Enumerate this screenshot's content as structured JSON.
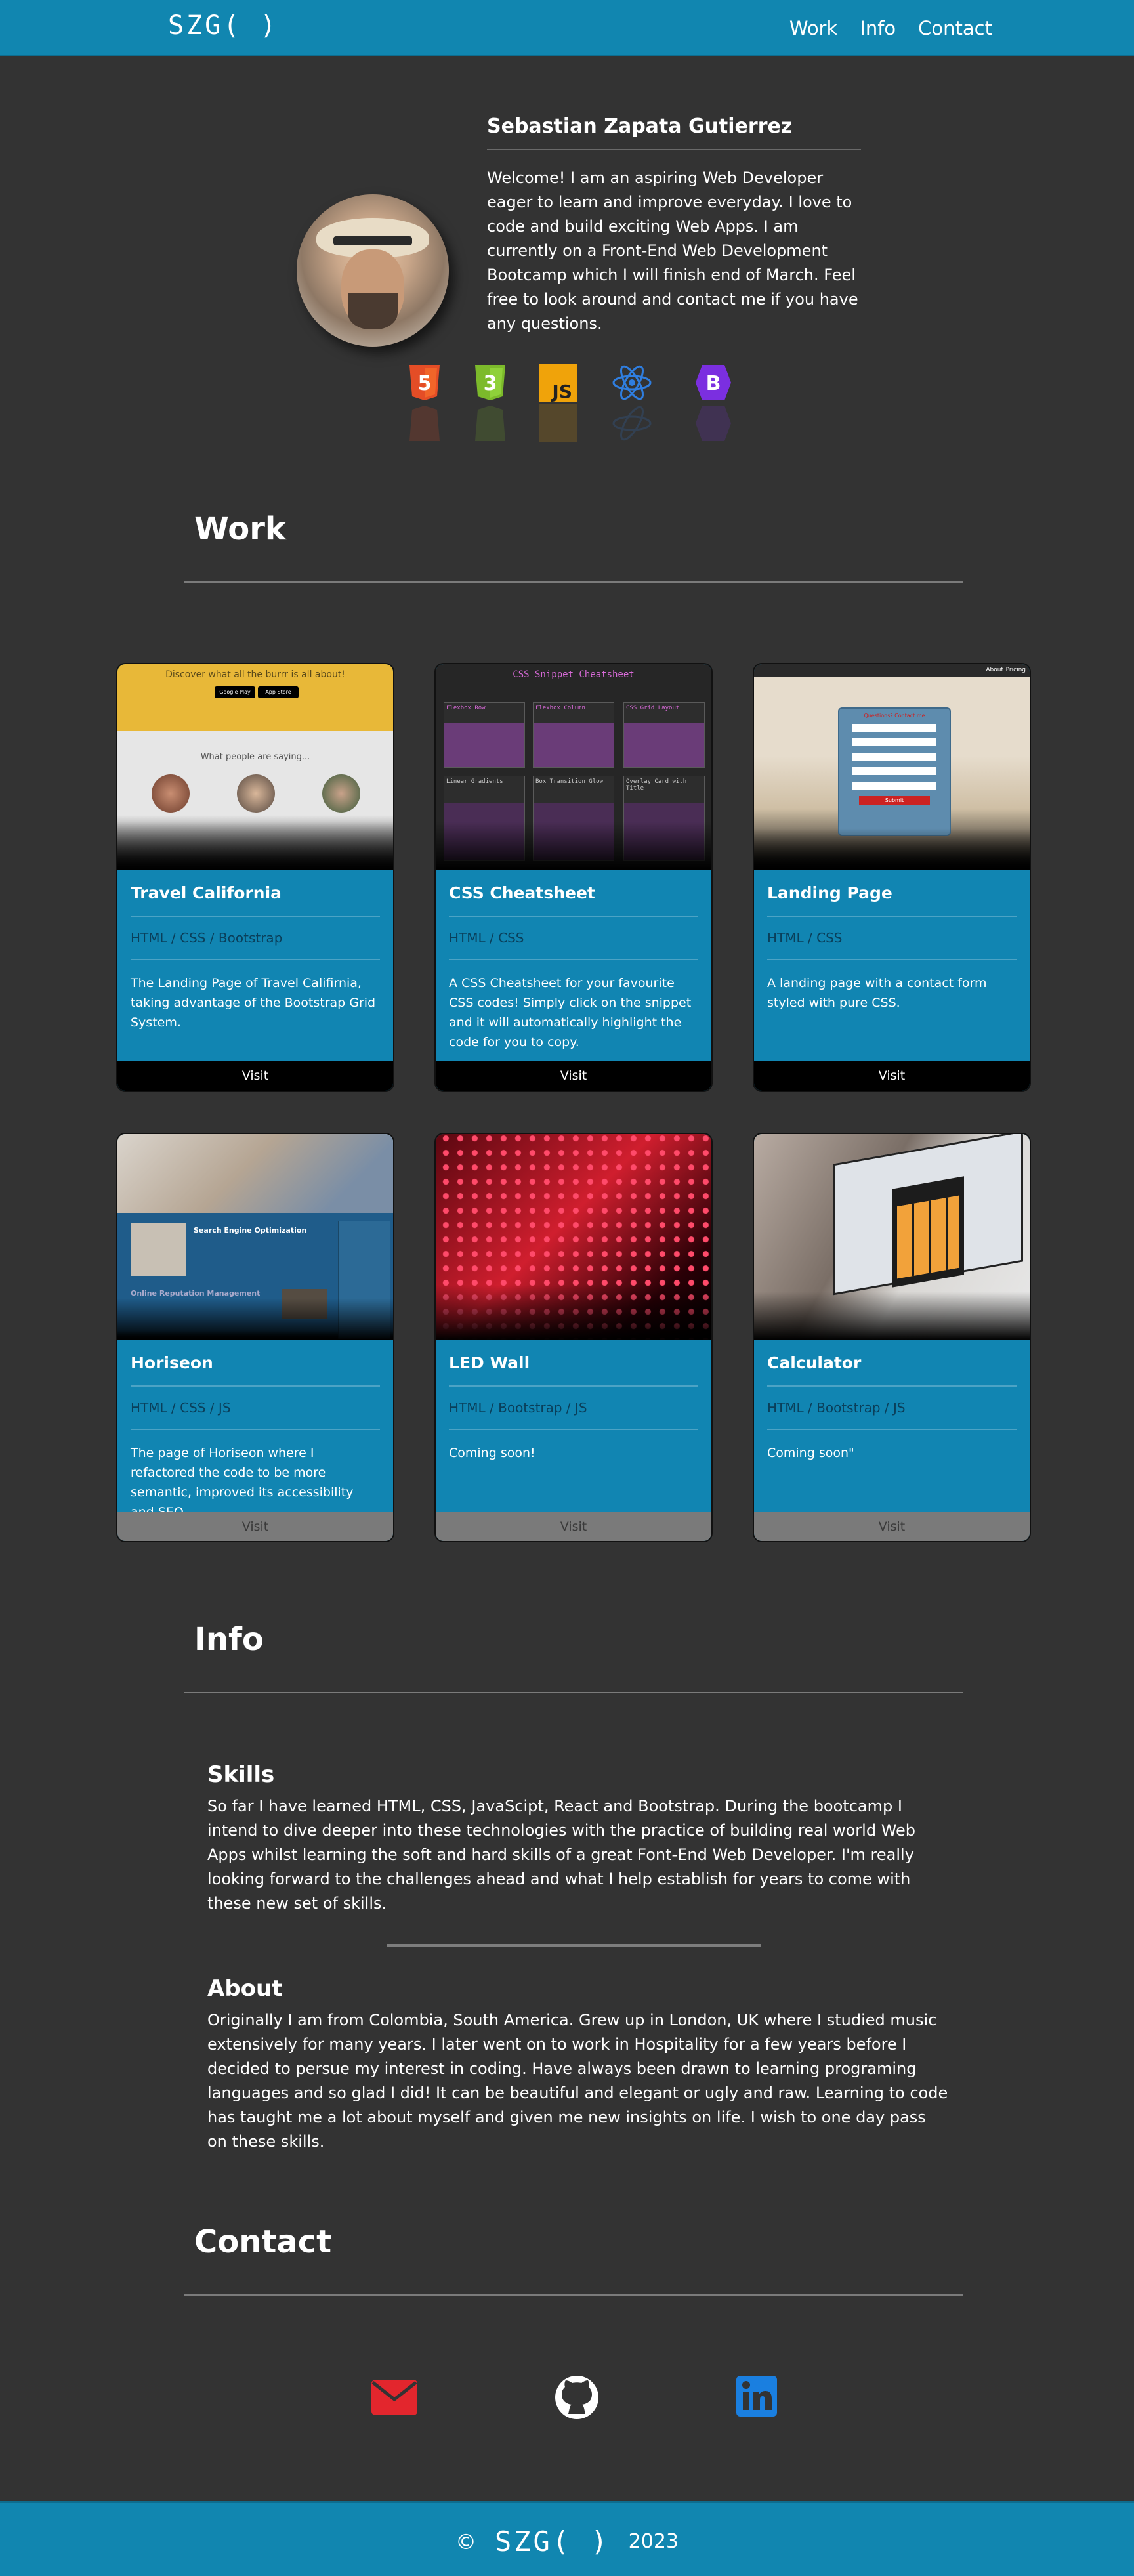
{
  "nav": {
    "brand": "SZG( )",
    "links": [
      "Work",
      "Info",
      "Contact"
    ]
  },
  "hero": {
    "name": "Sebastian Zapata Gutierrez",
    "bio": "Welcome! I am an aspiring Web Developer eager to learn and improve everyday. I love to code and build exciting Web Apps. I am currently on a Front-End Web Development Bootcamp which I will finish end of March. Feel free to look around and contact me if you have any questions."
  },
  "tech_icons": [
    "html5-icon",
    "css3-icon",
    "javascript-icon",
    "react-icon",
    "bootstrap-icon"
  ],
  "work": {
    "title": "Work",
    "cards": [
      {
        "title": "Travel California",
        "tech": "HTML / CSS / Bootstrap",
        "desc": "The Landing Page of Travel Califirnia, taking advantage of the Bootstrap Grid System.",
        "visit": "Visit",
        "enabled": true,
        "thumb_text_top": "Discover what all the burrr is all about!",
        "thumb_text_mid": "What people are saying...",
        "thumb_store_1": "Google Play",
        "thumb_store_2": "App Store"
      },
      {
        "title": "CSS Cheatsheet",
        "tech": "HTML / CSS",
        "desc": "A CSS Cheatsheet for your favourite CSS codes! Simply click on the snippet and it will automatically highlight the code for you to copy.",
        "visit": "Visit",
        "enabled": true,
        "thumb_title": "CSS Snippet Cheatsheet",
        "thumb_cells": [
          "Flexbox Row",
          "Flexbox Column",
          "CSS Grid Layout",
          "Linear Gradients",
          "Box Transition Glow",
          "Overlay Card with Title"
        ]
      },
      {
        "title": "Landing Page",
        "tech": "HTML / CSS",
        "desc": "A landing page with a contact form styled with pure CSS.",
        "visit": "Visit",
        "enabled": true,
        "thumb_nav": [
          "About",
          "Pricing"
        ],
        "thumb_form_title": "Questions? Contact me",
        "thumb_form_button": "Submit"
      },
      {
        "title": "Horiseon",
        "tech": "HTML / CSS / JS",
        "desc": "The page of Horiseon where I refactored the code to be more semantic, improved its accessibility and SEO.",
        "visit": "Visit",
        "enabled": false,
        "thumb_heading_1": "Search Engine Optimization",
        "thumb_heading_2": "Online Reputation Management"
      },
      {
        "title": "LED Wall",
        "tech": "HTML / Bootstrap / JS",
        "desc": "Coming soon!",
        "visit": "Visit",
        "enabled": false
      },
      {
        "title": "Calculator",
        "tech": "HTML / Bootstrap / JS",
        "desc": "Coming soon\"",
        "visit": "Visit",
        "enabled": false
      }
    ]
  },
  "info": {
    "title": "Info",
    "skills_title": "Skills",
    "skills_text": "So far I have learned HTML, CSS, JavaScipt, React and Bootstrap. During the bootcamp I intend to dive deeper into these technologies with the practice of building real world Web Apps whilst learning the soft and hard skills of a great Font-End Web Developer. I'm really looking forward to the challenges ahead and what I help establish for years to come with these new set of skills.",
    "about_title": "About",
    "about_text": "Originally I am from Colombia, South America. Grew up in London, UK where I studied music extensively for many years. I later went on to work in Hospitality for a few years before I decided to persue my interest in coding. Have always been drawn to learning programing languages and so glad I did! It can be beautiful and elegant or ugly and raw. Learning to code has taught me a lot about myself and given me new insights on life. I wish to one day pass on these skills."
  },
  "contact": {
    "title": "Contact",
    "icons": [
      "email-icon",
      "github-icon",
      "linkedin-icon"
    ]
  },
  "footer": {
    "copyright": "©",
    "brand": "SZG( )",
    "year": "2023"
  },
  "colors": {
    "primary": "#1186b0",
    "background": "#333333",
    "email": "#e3262d",
    "linkedin": "#1a7fe0"
  }
}
